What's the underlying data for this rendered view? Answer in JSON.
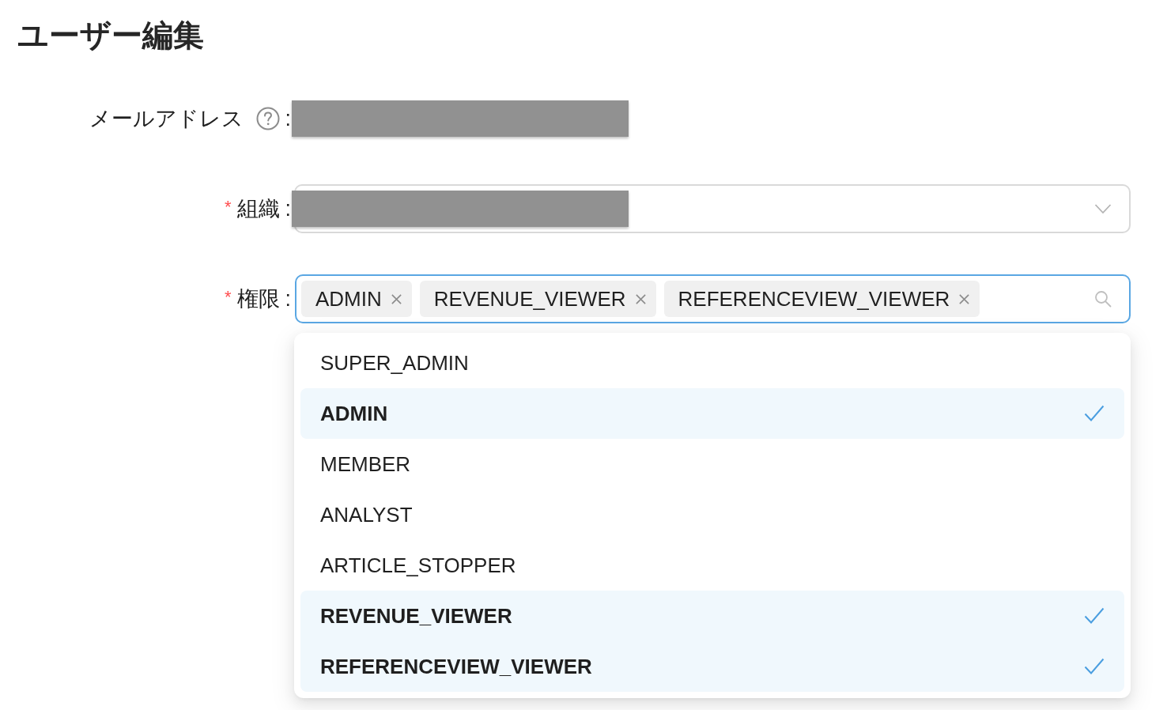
{
  "title": "ユーザー編集",
  "form": {
    "fields": [
      {
        "kind": "text",
        "label": "メールアドレス",
        "help": true,
        "colon": ":",
        "redacted": true
      },
      {
        "kind": "select",
        "required_mark": "*",
        "label": "組織",
        "colon": ":",
        "redacted": true
      },
      {
        "kind": "multiselect",
        "required_mark": "*",
        "label": "権限",
        "colon": ":",
        "focused": true,
        "tags": [
          {
            "label": "ADMIN"
          },
          {
            "label": "REVENUE_VIEWER"
          },
          {
            "label": "REFERENCEVIEW_VIEWER"
          }
        ],
        "options": [
          {
            "label": "SUPER_ADMIN",
            "selected": false
          },
          {
            "label": "ADMIN",
            "selected": true
          },
          {
            "label": "MEMBER",
            "selected": false
          },
          {
            "label": "ANALYST",
            "selected": false
          },
          {
            "label": "ARTICLE_STOPPER",
            "selected": false
          },
          {
            "label": "REVENUE_VIEWER",
            "selected": true
          },
          {
            "label": "REFERENCEVIEW_VIEWER",
            "selected": true
          }
        ]
      }
    ]
  }
}
